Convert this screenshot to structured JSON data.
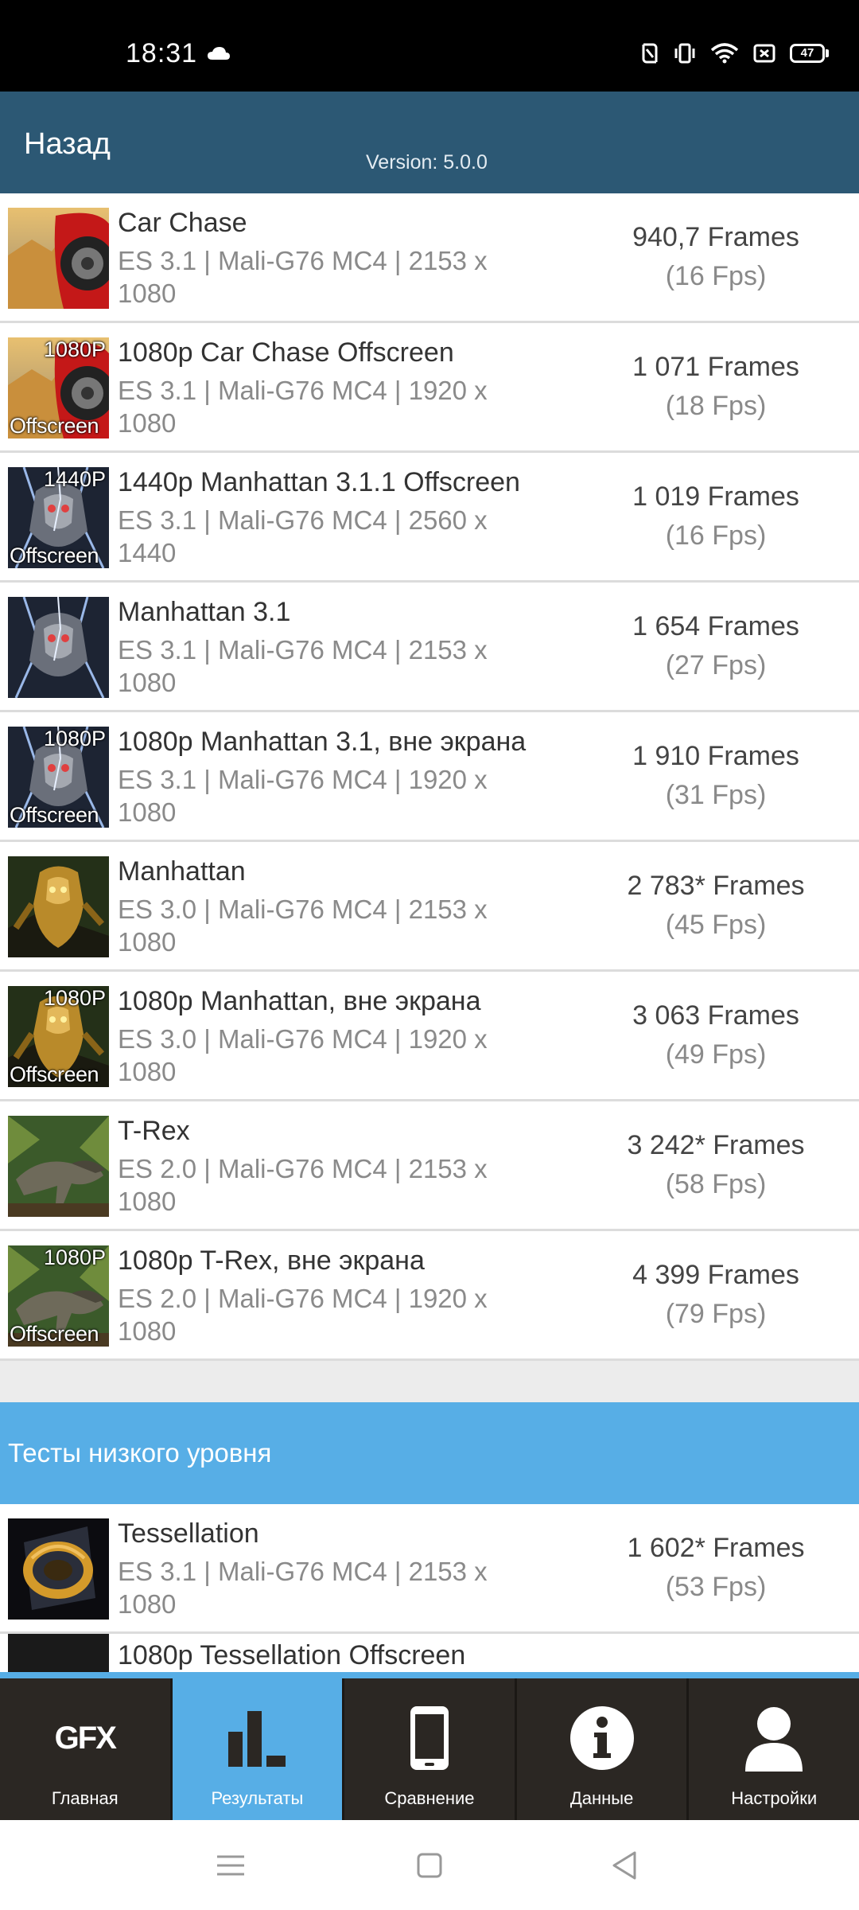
{
  "status": {
    "time": "18:31",
    "battery": "47"
  },
  "header": {
    "back_label": "Назад",
    "version": "Version: 5.0.0"
  },
  "results": [
    {
      "title": "Car Chase",
      "sub": "ES 3.1 | Mali-G76 MC4 | 2153 x 1080",
      "frames": "940,7 Frames",
      "fps": "(16 Fps)",
      "thumb": "car",
      "badge_top": "",
      "badge_bottom": ""
    },
    {
      "title": "1080p Car Chase Offscreen",
      "sub": "ES 3.1 | Mali-G76 MC4 | 1920 x 1080",
      "frames": "1 071 Frames",
      "fps": "(18 Fps)",
      "thumb": "car",
      "badge_top": "1080P",
      "badge_bottom": "Offscreen"
    },
    {
      "title": "1440p Manhattan 3.1.1 Offscreen",
      "sub": "ES 3.1 | Mali-G76 MC4 | 2560 x 1440",
      "frames": "1 019 Frames",
      "fps": "(16 Fps)",
      "thumb": "robot",
      "badge_top": "1440P",
      "badge_bottom": "Offscreen"
    },
    {
      "title": "Manhattan 3.1",
      "sub": "ES 3.1 | Mali-G76 MC4 | 2153 x 1080",
      "frames": "1 654 Frames",
      "fps": "(27 Fps)",
      "thumb": "robot",
      "badge_top": "",
      "badge_bottom": ""
    },
    {
      "title": "1080p Manhattan 3.1, вне экрана",
      "sub": "ES 3.1 | Mali-G76 MC4 | 1920 x 1080",
      "frames": "1 910 Frames",
      "fps": "(31 Fps)",
      "thumb": "robot",
      "badge_top": "1080P",
      "badge_bottom": "Offscreen"
    },
    {
      "title": "Manhattan",
      "sub": "ES 3.0 | Mali-G76 MC4 | 2153 x 1080",
      "frames": "2 783* Frames",
      "fps": "(45 Fps)",
      "thumb": "gold",
      "badge_top": "",
      "badge_bottom": ""
    },
    {
      "title": "1080p Manhattan, вне экрана",
      "sub": "ES 3.0 | Mali-G76 MC4 | 1920 x 1080",
      "frames": "3 063 Frames",
      "fps": "(49 Fps)",
      "thumb": "gold",
      "badge_top": "1080P",
      "badge_bottom": "Offscreen"
    },
    {
      "title": "T-Rex",
      "sub": "ES 2.0 | Mali-G76 MC4 | 2153 x 1080",
      "frames": "3 242* Frames",
      "fps": "(58 Fps)",
      "thumb": "trex",
      "badge_top": "",
      "badge_bottom": ""
    },
    {
      "title": "1080p T-Rex, вне экрана",
      "sub": "ES 2.0 | Mali-G76 MC4 | 1920 x 1080",
      "frames": "4 399 Frames",
      "fps": "(79 Fps)",
      "thumb": "trex",
      "badge_top": "1080P",
      "badge_bottom": "Offscreen"
    }
  ],
  "section": {
    "label": "Тесты низкого уровня"
  },
  "low_level": [
    {
      "title": "Tessellation",
      "sub": "ES 3.1 | Mali-G76 MC4 | 2153 x 1080",
      "frames": "1 602* Frames",
      "fps": "(53 Fps)",
      "thumb": "tess",
      "badge_top": "",
      "badge_bottom": ""
    }
  ],
  "partial_row": {
    "title": "1080p Tessellation Offscreen"
  },
  "nav": {
    "items": [
      {
        "label": "Главная",
        "icon": "gfx-logo-icon",
        "logo_text": "GFX"
      },
      {
        "label": "Результаты",
        "icon": "bar-chart-icon"
      },
      {
        "label": "Сравнение",
        "icon": "phone-icon"
      },
      {
        "label": "Данные",
        "icon": "info-icon"
      },
      {
        "label": "Настройки",
        "icon": "user-icon"
      }
    ],
    "active_index": 1
  },
  "colors": {
    "header": "#2c5874",
    "accent": "#57aee6",
    "nav_bg": "#2b2723"
  }
}
